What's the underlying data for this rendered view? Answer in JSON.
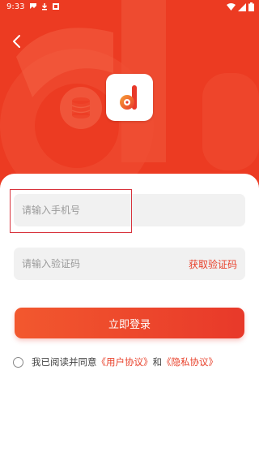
{
  "status_bar": {
    "time": "9:33",
    "left_icons": [
      "image-icon",
      "download-icon",
      "app-icon"
    ],
    "right_icons": [
      "wifi-icon",
      "signal-icon",
      "battery-icon"
    ]
  },
  "colors": {
    "brand": "#ec3b22",
    "accent_text": "#e8402a",
    "field_bg": "#f1f1f1"
  },
  "form": {
    "phone_placeholder": "请输入手机号",
    "code_placeholder": "请输入验证码",
    "get_code_label": "获取验证码",
    "login_label": "立即登录"
  },
  "agreement": {
    "prefix": "我已阅读并同意",
    "user_agreement": "《用户协议》",
    "conjunction": "和",
    "privacy_agreement": "《隐私协议》"
  }
}
